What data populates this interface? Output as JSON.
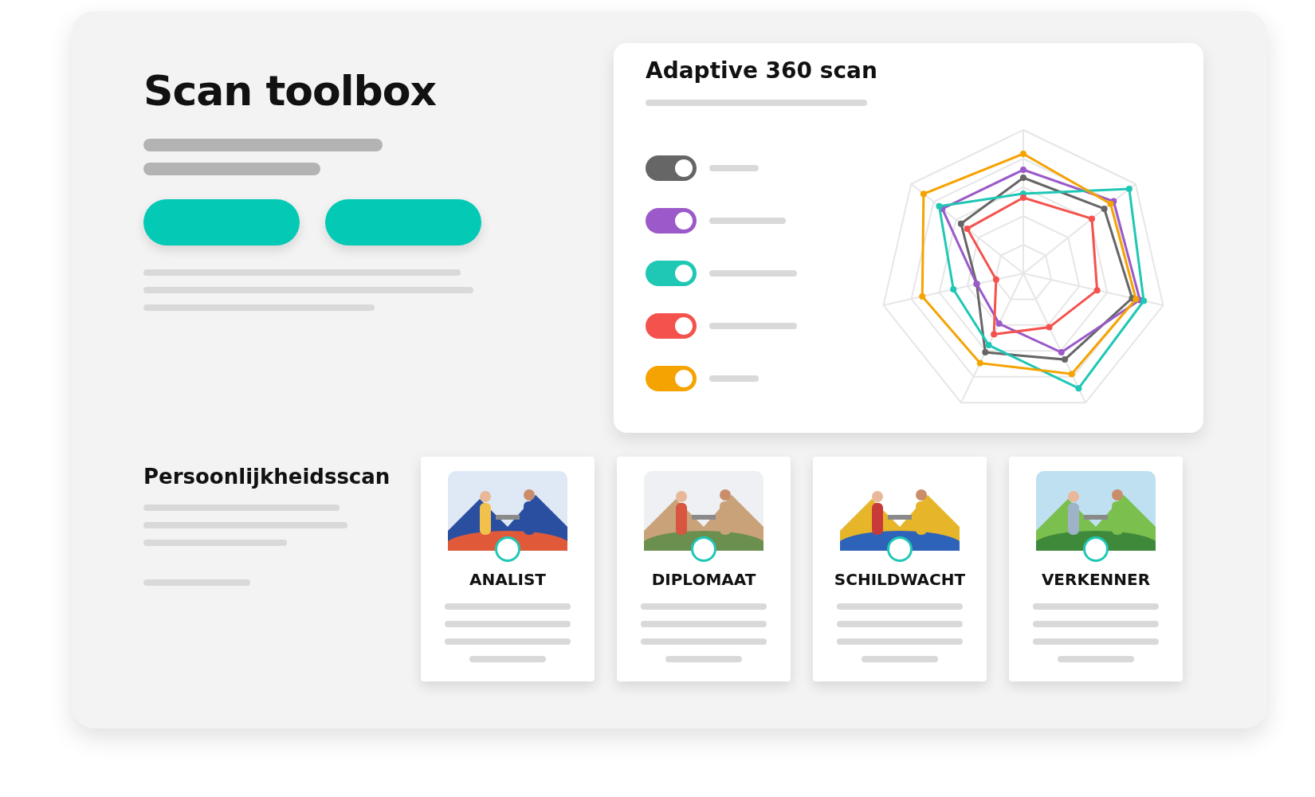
{
  "header": {
    "title": "Scan toolbox",
    "buttons": [
      {
        "kind": "primary"
      },
      {
        "kind": "primary"
      }
    ]
  },
  "scan_card": {
    "title": "Adaptive 360 scan",
    "toggles": [
      {
        "on": true,
        "color": "#666666"
      },
      {
        "on": true,
        "color": "#9b59c9"
      },
      {
        "on": true,
        "color": "#1fc7b5"
      },
      {
        "on": true,
        "color": "#f4524d"
      },
      {
        "on": true,
        "color": "#f5a300"
      }
    ]
  },
  "personality": {
    "title": "Persoonlijkheidsscan",
    "cards": [
      {
        "label": "ANALIST",
        "kind": "picture"
      },
      {
        "label": "DIPLOMAAT",
        "kind": "picture"
      },
      {
        "label": "SCHILDWACHT",
        "kind": "picture"
      },
      {
        "label": "VERKENNER",
        "kind": "picture"
      }
    ]
  }
}
